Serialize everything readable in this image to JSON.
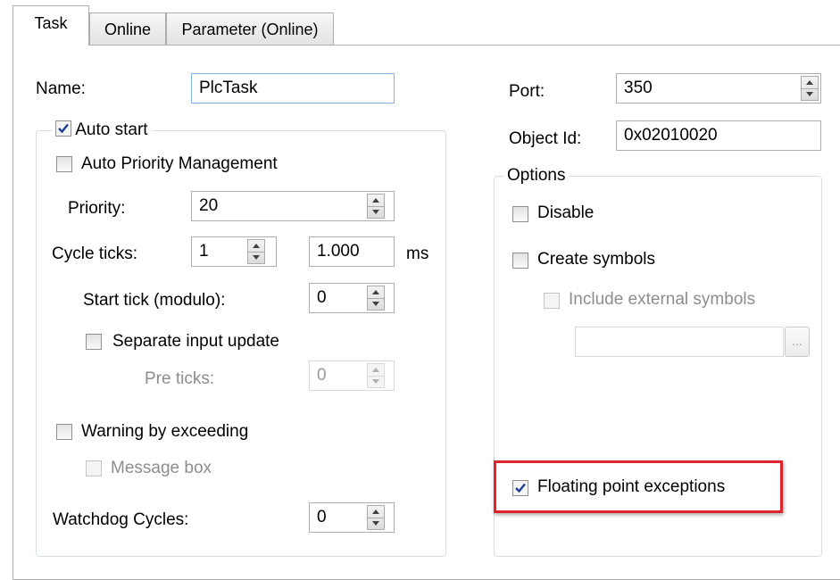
{
  "tabs": [
    {
      "label": "Task",
      "active": true
    },
    {
      "label": "Online",
      "active": false
    },
    {
      "label": "Parameter (Online)",
      "active": false
    }
  ],
  "left": {
    "name_label": "Name:",
    "name_value": "PlcTask",
    "auto_start": {
      "label": "Auto start",
      "checked": true
    },
    "auto_priority": {
      "label": "Auto Priority Management",
      "checked": false
    },
    "priority_label": "Priority:",
    "priority_value": "20",
    "cycle_ticks_label": "Cycle ticks:",
    "cycle_ticks_value": "1",
    "cycle_time_value": "1.000",
    "cycle_unit": "ms",
    "start_tick_label": "Start tick (modulo):",
    "start_tick_value": "0",
    "separate_input": {
      "label": "Separate input update",
      "checked": false
    },
    "pre_ticks_label": "Pre ticks:",
    "pre_ticks_value": "0",
    "warning": {
      "label": "Warning by exceeding",
      "checked": false
    },
    "message_box": {
      "label": "Message box",
      "checked": false,
      "enabled": false
    },
    "watchdog_label": "Watchdog Cycles:",
    "watchdog_value": "0"
  },
  "right": {
    "port_label": "Port:",
    "port_value": "350",
    "object_id_label": "Object Id:",
    "object_id_value": "0x02010020",
    "options_legend": "Options",
    "disable": {
      "label": "Disable",
      "checked": false
    },
    "create_symbols": {
      "label": "Create symbols",
      "checked": false
    },
    "include_external": {
      "label": "Include external symbols",
      "checked": false,
      "enabled": false
    },
    "external_path_value": "",
    "browse_label": "...",
    "floating_point": {
      "label": "Floating point exceptions",
      "checked": true
    }
  },
  "colors": {
    "highlight": "#e0242b",
    "check": "#1c3f94"
  }
}
